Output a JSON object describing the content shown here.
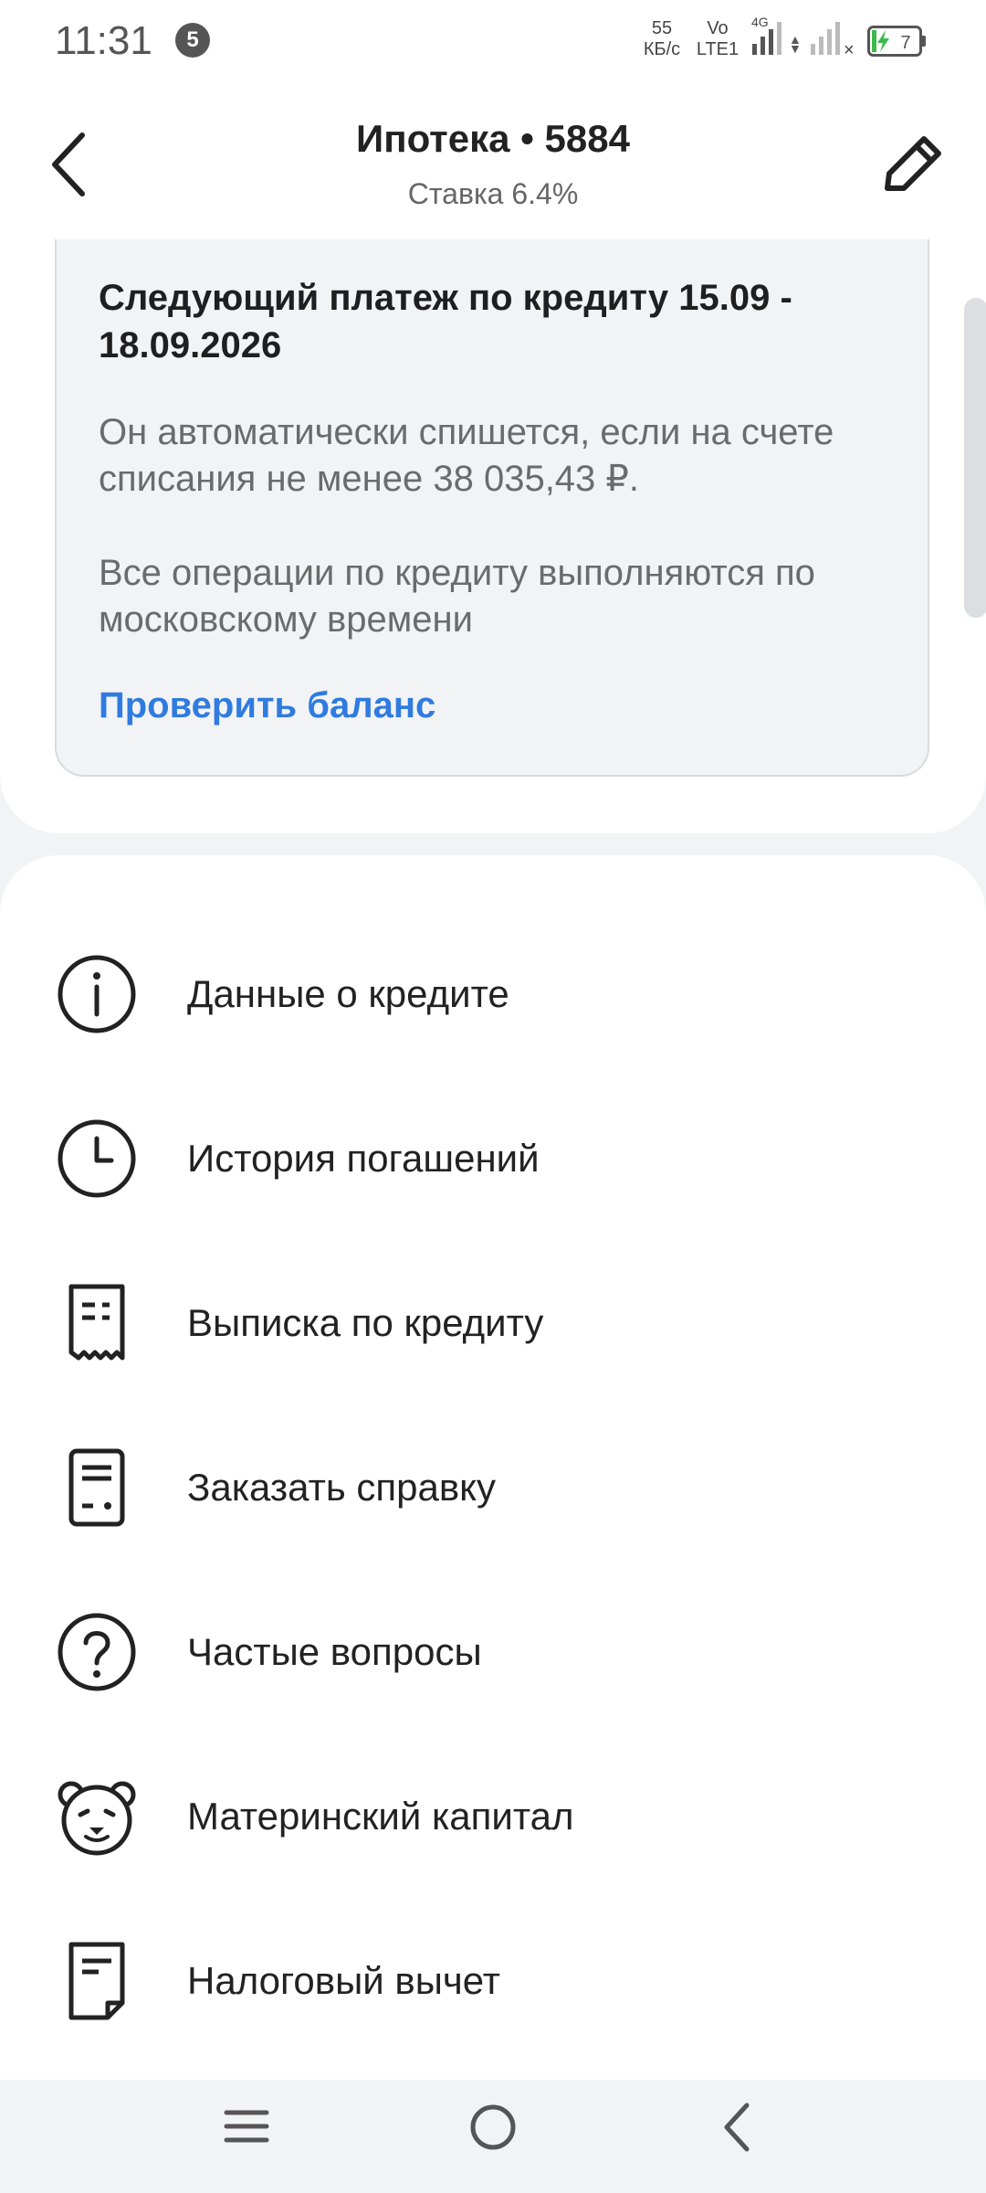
{
  "status_bar": {
    "time": "11:31",
    "notification_count": "5",
    "net_speed_value": "55",
    "net_speed_unit": "КБ/с",
    "volte_top": "Vo",
    "volte_bottom": "LTE1",
    "network_type": "4G",
    "battery_level": "7",
    "icons": [
      "signal-icon",
      "data-arrows-icon",
      "signal-icon",
      "battery-charging-icon"
    ]
  },
  "header": {
    "title": "Ипотека • 5884",
    "subtitle": "Ставка 6.4%",
    "icons": [
      "back-icon",
      "edit-icon"
    ]
  },
  "card": {
    "title": "Следующий платеж по кредиту 15.09 - 18.09.2026",
    "text1": "Он автоматически спишется, если на счете списания не менее 38 035,43 ₽.",
    "text2": "Все операции по кредиту выполняются по московскому времени",
    "link": "Проверить баланс"
  },
  "menu": {
    "items": [
      {
        "label": "Данные о кредите",
        "icon": "info-icon"
      },
      {
        "label": "История погашений",
        "icon": "clock-icon"
      },
      {
        "label": "Выписка по кредиту",
        "icon": "receipt-icon"
      },
      {
        "label": "Заказать справку",
        "icon": "document-icon"
      },
      {
        "label": "Частые вопросы",
        "icon": "question-icon"
      },
      {
        "label": "Материнский капитал",
        "icon": "bear-icon"
      },
      {
        "label": "Налоговый вычет",
        "icon": "tax-document-icon"
      }
    ]
  },
  "nav_bar": {
    "icons": [
      "menu-icon",
      "home-icon",
      "back-icon"
    ]
  },
  "colors": {
    "accent_link": "#2f7be0",
    "background": "#f2f3f5",
    "battery_charge": "#3dba4e"
  }
}
